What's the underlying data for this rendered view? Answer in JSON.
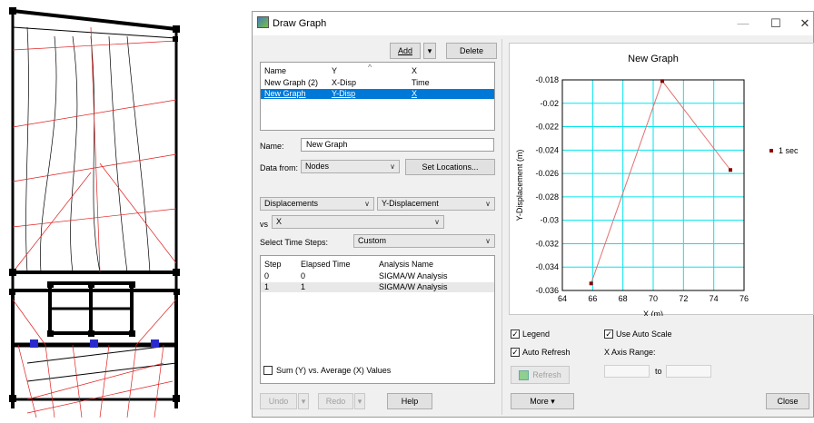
{
  "window": {
    "title": "Draw Graph"
  },
  "toolbar": {
    "add_label": "Add",
    "delete_label": "Delete"
  },
  "graph_list": {
    "headers": {
      "name": "Name",
      "y": "Y",
      "x": "X"
    },
    "rows": [
      {
        "name": "New Graph (2)",
        "y": "X-Disp",
        "x": "Time",
        "selected": false
      },
      {
        "name": "New Graph",
        "y": "Y-Disp",
        "x": "X",
        "selected": true
      }
    ]
  },
  "form": {
    "name_label": "Name:",
    "name_value": "New Graph",
    "data_from_label": "Data from:",
    "data_from_value": "Nodes",
    "set_locations_label": "Set Locations...",
    "category_value": "Displacements",
    "y_param_value": "Y-Displacement",
    "vs_label": "vs",
    "x_param_value": "X",
    "time_steps_label": "Select Time Steps:",
    "time_steps_value": "Custom"
  },
  "steps_table": {
    "headers": {
      "step": "Step",
      "elapsed": "Elapsed Time",
      "analysis": "Analysis Name"
    },
    "rows": [
      {
        "step": "0",
        "elapsed": "0",
        "analysis": "SIGMA/W Analysis"
      },
      {
        "step": "1",
        "elapsed": "1",
        "analysis": "SIGMA/W Analysis"
      }
    ]
  },
  "sum_vs_avg_label": "Sum (Y) vs. Average (X) Values",
  "bottom_left": {
    "undo_label": "Undo",
    "redo_label": "Redo",
    "help_label": "Help"
  },
  "options": {
    "legend_label": "Legend",
    "legend_checked": true,
    "auto_refresh_label": "Auto Refresh",
    "auto_refresh_checked": true,
    "refresh_label": "Refresh",
    "use_auto_scale_label": "Use Auto Scale",
    "use_auto_scale_checked": true,
    "x_axis_range_label": "X Axis Range:",
    "to_label": "to",
    "more_label": "More",
    "close_label": "Close"
  },
  "colors": {
    "selection": "#0078d7",
    "grid": "#00e5ee",
    "series": "#8b0000",
    "line": "#e07070"
  },
  "chart_data": {
    "type": "line",
    "title": "New Graph",
    "xlabel": "X (m)",
    "ylabel": "Y-Displacement (m)",
    "xlim": [
      64,
      76
    ],
    "ylim": [
      -0.036,
      -0.018
    ],
    "xticks": [
      "64",
      "66",
      "68",
      "70",
      "72",
      "74",
      "76"
    ],
    "yticks": [
      "-0.018",
      "-0.02",
      "-0.022",
      "-0.024",
      "-0.026",
      "-0.028",
      "-0.03",
      "-0.032",
      "-0.034",
      "-0.036"
    ],
    "grid": true,
    "legend_position": "right",
    "series": [
      {
        "name": "1 sec",
        "x": [
          65.9,
          70.6,
          75.1
        ],
        "y": [
          -0.0354,
          -0.0181,
          -0.0257
        ]
      }
    ]
  }
}
